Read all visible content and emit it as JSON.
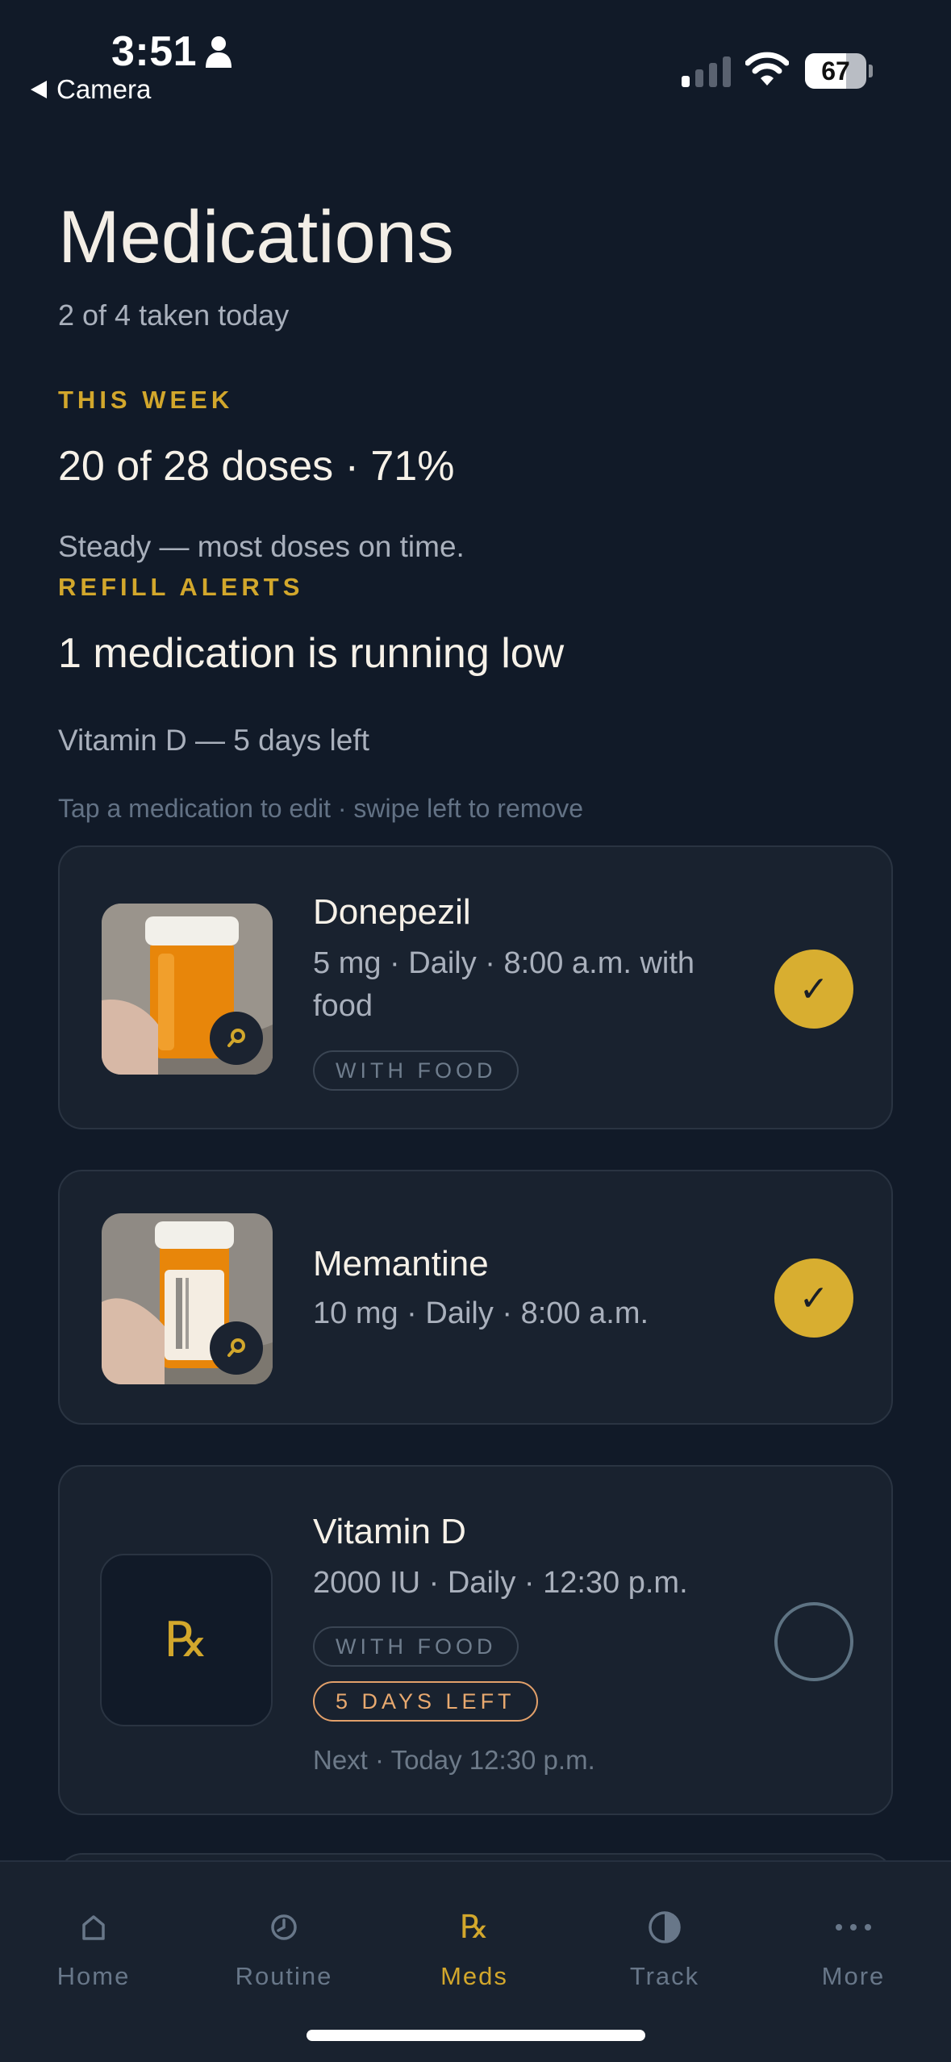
{
  "status_bar": {
    "time": "3:51",
    "back_label": "Camera",
    "battery": "67",
    "battery_level": 0.67
  },
  "header": {
    "title": "Medications",
    "subtitle": "2 of 4 taken today"
  },
  "this_week": {
    "label": "THIS WEEK",
    "stat": "20 of 28 doses · 71%",
    "note": "Steady — most doses on time."
  },
  "refill_alerts": {
    "label": "REFILL ALERTS",
    "stat": "1 medication is running low",
    "note": "Vitamin D — 5 days left"
  },
  "hint": "Tap a medication to edit · swipe left to remove",
  "medications": [
    {
      "name": "Donepezil",
      "detail": "5 mg · Daily · 8:00 a.m. with food",
      "tag": "WITH FOOD",
      "taken": true,
      "check": "✓"
    },
    {
      "name": "Memantine",
      "detail": "10 mg · Daily · 8:00 a.m.",
      "taken": true,
      "check": "✓"
    },
    {
      "name": "Vitamin D",
      "detail": "2000 IU · Daily · 12:30 p.m.",
      "tag": "WITH FOOD",
      "warning": "5 DAYS LEFT",
      "next": "Next · Today 12:30 p.m.",
      "icon": "℞",
      "taken": false
    }
  ],
  "tabbar": {
    "items": [
      {
        "label": "Home",
        "icon": "home-icon"
      },
      {
        "label": "Routine",
        "icon": "clock-icon"
      },
      {
        "label": "Meds",
        "icon": "rx-icon",
        "glyph": "℞",
        "active": true
      },
      {
        "label": "Track",
        "icon": "half-circle-icon"
      },
      {
        "label": "More",
        "icon": "more-dots-icon"
      }
    ]
  },
  "colors": {
    "background": "#111a28",
    "card": "#19222f",
    "accent": "#d2a72c",
    "warning": "#e8a96f"
  }
}
